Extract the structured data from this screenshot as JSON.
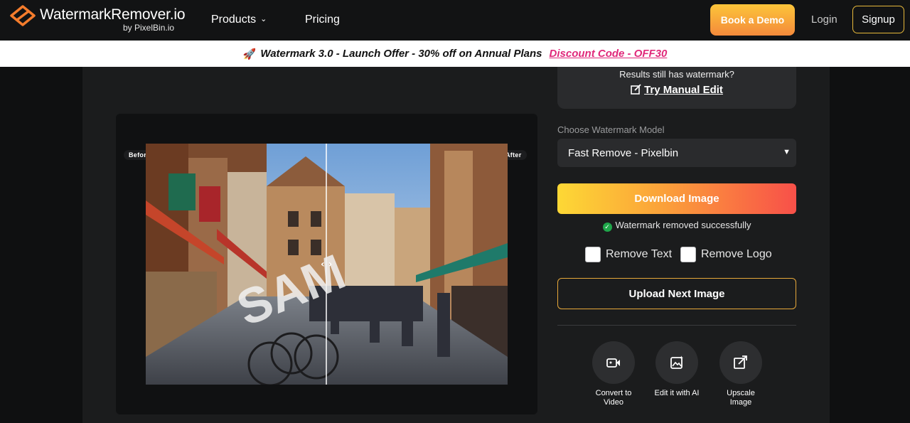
{
  "nav": {
    "brand": "WatermarkRemover.io",
    "brand_sub": "by PixelBin.io",
    "products": "Products",
    "pricing": "Pricing",
    "book_demo": "Book a Demo",
    "login": "Login",
    "signup": "Signup"
  },
  "banner": {
    "rocket": "🚀",
    "text": "Watermark 3.0 - Launch Offer - 30% off on Annual Plans",
    "code": "Discount Code - OFF30"
  },
  "preview": {
    "before": "Before",
    "after": "After",
    "watermark_text": "SAM"
  },
  "result": {
    "question": "Results still has watermark?",
    "manual_edit": "Try Manual Edit"
  },
  "model": {
    "label": "Choose Watermark Model",
    "selected": "Fast Remove - Pixelbin"
  },
  "download": "Download Image",
  "success": "Watermark removed successfully",
  "options": {
    "remove_text": "Remove Text",
    "remove_logo": "Remove Logo",
    "remove_text_checked": false,
    "remove_logo_checked": false
  },
  "upload_next": "Upload Next Image",
  "tools": [
    {
      "label_1": "Convert to",
      "label_2": "Video",
      "icon": "video-convert-icon"
    },
    {
      "label_1": "Edit it with AI",
      "label_2": "",
      "icon": "ai-edit-icon"
    },
    {
      "label_1": "Upscale",
      "label_2": "Image",
      "icon": "upscale-icon"
    }
  ],
  "colors": {
    "accent_gradient_start": "#fdd835",
    "accent_gradient_end": "#f85049",
    "discount_code": "#e0287a",
    "success": "#1fa64a"
  }
}
